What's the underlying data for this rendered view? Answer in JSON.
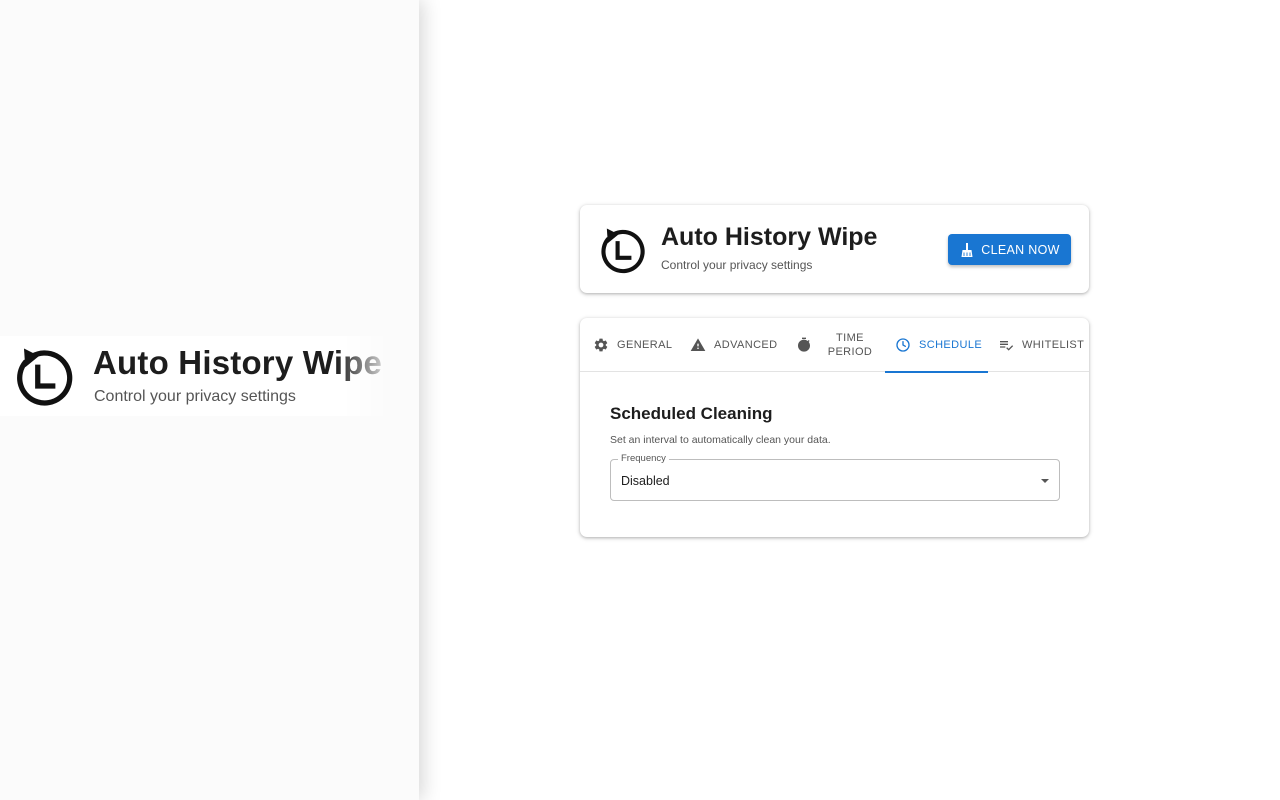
{
  "app": {
    "title": "Auto History Wipe",
    "subtitle": "Control your privacy settings"
  },
  "header": {
    "clean_button_label": "CLEAN NOW",
    "clean_button_icon": "broom-icon"
  },
  "tabs": [
    {
      "label": "GENERAL",
      "icon": "gear-icon",
      "active": false
    },
    {
      "label": "ADVANCED",
      "icon": "warning-icon",
      "active": false
    },
    {
      "label": "TIME PERIOD",
      "icon": "timer-icon",
      "active": false
    },
    {
      "label": "SCHEDULE",
      "icon": "clock-icon",
      "active": true
    },
    {
      "label": "WHITELIST",
      "icon": "playlist-check-icon",
      "active": false
    }
  ],
  "schedule": {
    "title": "Scheduled Cleaning",
    "description": "Set an interval to automatically clean your data.",
    "frequency_label": "Frequency",
    "frequency_value": "Disabled"
  },
  "colors": {
    "accent": "#1976d2",
    "text": "#1d1d1d",
    "muted": "#555555"
  }
}
